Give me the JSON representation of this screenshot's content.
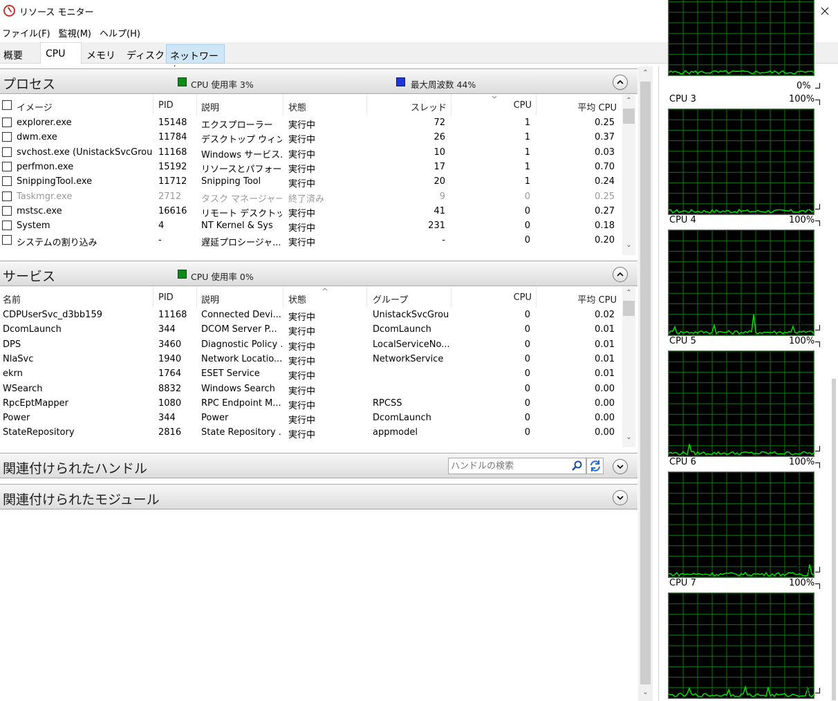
{
  "window": {
    "title": "リソース モニター"
  },
  "menu": [
    "ファイル(F)",
    "監視(M)",
    "ヘルプ(H)"
  ],
  "tabs": {
    "overview": "概要",
    "cpu": "CPU",
    "memory": "メモリ",
    "disk": "ディスク",
    "network": "ネットワーク",
    "active": "CPU"
  },
  "processes": {
    "title": "プロセス",
    "cpu_usage": "CPU 使用率 3%",
    "max_freq": "最大周波数 44%",
    "columns": [
      "イメージ",
      "PID",
      "説明",
      "状態",
      "スレッド",
      "CPU",
      "平均 CPU"
    ],
    "rows": [
      {
        "image": "explorer.exe",
        "pid": "15148",
        "desc": "エクスプローラー",
        "status": "実行中",
        "threads": "72",
        "cpu": "1",
        "avg": "0.25"
      },
      {
        "image": "dwm.exe",
        "pid": "11784",
        "desc": "デスクトップ ウィン...",
        "status": "実行中",
        "threads": "26",
        "cpu": "1",
        "avg": "0.37"
      },
      {
        "image": "svchost.exe (UnistackSvcGroup)",
        "pid": "11168",
        "desc": "Windows サービス...",
        "status": "実行中",
        "threads": "10",
        "cpu": "1",
        "avg": "0.03"
      },
      {
        "image": "perfmon.exe",
        "pid": "15192",
        "desc": "リソースとパフォーマ...",
        "status": "実行中",
        "threads": "17",
        "cpu": "1",
        "avg": "0.70"
      },
      {
        "image": "SnippingTool.exe",
        "pid": "11712",
        "desc": "Snipping Tool",
        "status": "実行中",
        "threads": "20",
        "cpu": "1",
        "avg": "0.24"
      },
      {
        "image": "Taskmgr.exe",
        "pid": "2712",
        "desc": "タスク マネージャー",
        "status": "終了済み",
        "threads": "9",
        "cpu": "0",
        "avg": "0.25",
        "terminated": true
      },
      {
        "image": "mstsc.exe",
        "pid": "16616",
        "desc": "リモート デスクトップ",
        "status": "実行中",
        "threads": "41",
        "cpu": "0",
        "avg": "0.27"
      },
      {
        "image": "System",
        "pid": "4",
        "desc": "NT Kernel & Sys",
        "status": "実行中",
        "threads": "231",
        "cpu": "0",
        "avg": "0.18"
      },
      {
        "image": "システムの割り込み",
        "pid": "-",
        "desc": "遅延プロシージャ...",
        "status": "実行中",
        "threads": "-",
        "cpu": "0",
        "avg": "0.20"
      }
    ]
  },
  "services": {
    "title": "サービス",
    "cpu_usage": "CPU 使用率 0%",
    "columns": [
      "名前",
      "PID",
      "説明",
      "状態",
      "グループ",
      "CPU",
      "平均 CPU"
    ],
    "rows": [
      {
        "name": "CDPUserSvc_d3bb159",
        "pid": "11168",
        "desc": "Connected Devi...",
        "status": "実行中",
        "group": "UnistackSvcGroup",
        "cpu": "0",
        "avg": "0.02"
      },
      {
        "name": "DcomLaunch",
        "pid": "344",
        "desc": "DCOM Server P...",
        "status": "実行中",
        "group": "DcomLaunch",
        "cpu": "0",
        "avg": "0.01"
      },
      {
        "name": "DPS",
        "pid": "3460",
        "desc": "Diagnostic Policy ...",
        "status": "実行中",
        "group": "LocalServiceNo...",
        "cpu": "0",
        "avg": "0.01"
      },
      {
        "name": "NlaSvc",
        "pid": "1940",
        "desc": "Network Locatio...",
        "status": "実行中",
        "group": "NetworkService",
        "cpu": "0",
        "avg": "0.01"
      },
      {
        "name": "ekrn",
        "pid": "1764",
        "desc": "ESET Service",
        "status": "実行中",
        "group": "",
        "cpu": "0",
        "avg": "0.01"
      },
      {
        "name": "WSearch",
        "pid": "8832",
        "desc": "Windows Search",
        "status": "実行中",
        "group": "",
        "cpu": "0",
        "avg": "0.00"
      },
      {
        "name": "RpcEptMapper",
        "pid": "1080",
        "desc": "RPC Endpoint M...",
        "status": "実行中",
        "group": "RPCSS",
        "cpu": "0",
        "avg": "0.00"
      },
      {
        "name": "Power",
        "pid": "344",
        "desc": "Power",
        "status": "実行中",
        "group": "DcomLaunch",
        "cpu": "0",
        "avg": "0.00"
      },
      {
        "name": "StateRepository",
        "pid": "2816",
        "desc": "State Repository ...",
        "status": "実行中",
        "group": "appmodel",
        "cpu": "0",
        "avg": "0.00"
      }
    ]
  },
  "handles": {
    "title": "関連付けられたハンドル",
    "search_placeholder": "ハンドルの検索"
  },
  "modules": {
    "title": "関連付けられたモジュール"
  },
  "graphs": {
    "max_label": "100%",
    "min_label": "0%",
    "items": [
      {
        "name": "CPU 3"
      },
      {
        "name": "CPU 4"
      },
      {
        "name": "CPU 5"
      },
      {
        "name": "CPU 6"
      },
      {
        "name": "CPU 7"
      }
    ]
  },
  "colors": {
    "graph_line": "#00e000",
    "graph_grid": "#0a7a0a",
    "chip_cpu": "#0f8a1a",
    "chip_freq": "#1f37d6",
    "active_tab_bg": "#cfe6f6"
  }
}
